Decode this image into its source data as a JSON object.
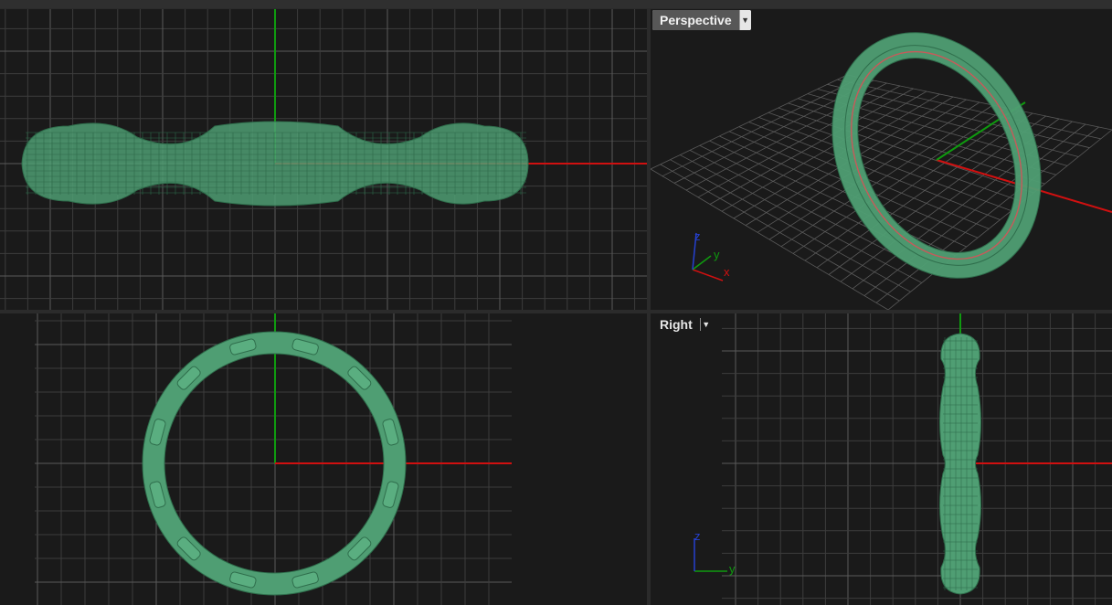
{
  "viewports": {
    "perspective": {
      "title": "Perspective",
      "menu_icon": "dropdown-arrow"
    },
    "right": {
      "title": "Right",
      "menu_icon": "dropdown-arrow"
    }
  },
  "axes": {
    "perspective": {
      "x": "x",
      "y": "y",
      "z": "z"
    },
    "right": {
      "y": "y",
      "z": "z"
    }
  },
  "colors": {
    "background": "#1a1a1a",
    "grid": "#3c3c3c",
    "grid_major": "#5a5a5a",
    "x_axis": "#d01010",
    "y_axis": "#0f9a0f",
    "z_axis": "#2540d0",
    "object": "#4f9e73",
    "object_wire": "#2f6e4c"
  }
}
